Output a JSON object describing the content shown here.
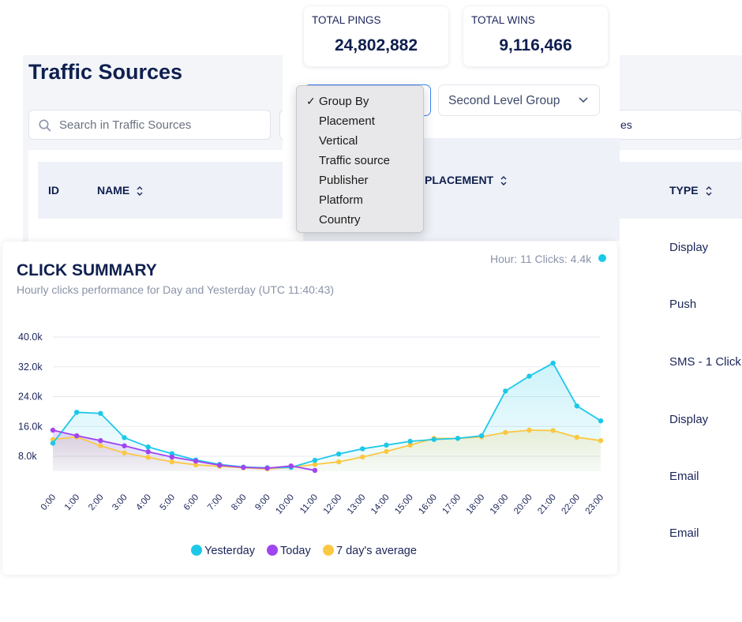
{
  "traffic_sources": {
    "title": "Traffic Sources",
    "search_placeholder": "Search in Traffic Sources",
    "filter_tail": "es",
    "columns": {
      "id": "ID",
      "name": "NAME",
      "placement": "PLACEMENT",
      "type": "TYPE"
    },
    "type_values": [
      "Display",
      "Push",
      "SMS - 1 Click",
      "Display",
      "Email",
      "Email"
    ]
  },
  "stats": {
    "total_pings_label": "TOTAL PINGS",
    "total_pings_value": "24,802,882",
    "total_wins_label": "TOTAL WINS",
    "total_wins_value": "9,116,466"
  },
  "group_by": {
    "second_level_label": "Second Level Group",
    "options": [
      "Group By",
      "Placement",
      "Vertical",
      "Traffic source",
      "Publisher",
      "Platform",
      "Country"
    ],
    "selected": "Group By"
  },
  "click_summary": {
    "title": "CLICK SUMMARY",
    "subtitle": "Hourly clicks performance for Day and Yesterday (UTC 11:40:43)",
    "tooltip": "Hour: 11 Clicks: 4.4k",
    "legend": [
      "Yesterday",
      "Today",
      "7 day's average"
    ]
  },
  "colors": {
    "yesterday": "#1cc8e8",
    "today": "#a145ef",
    "average": "#fbc843",
    "text": "#1b2559"
  },
  "chart_data": {
    "type": "area",
    "x": [
      "0:00",
      "1:00",
      "2:00",
      "3:00",
      "4:00",
      "5:00",
      "6:00",
      "7:00",
      "8:00",
      "9:00",
      "10:00",
      "11:00",
      "12:00",
      "13:00",
      "14:00",
      "15:00",
      "16:00",
      "17:00",
      "18:00",
      "19:00",
      "20:00",
      "21:00",
      "22:00",
      "23:00"
    ],
    "y_ticks": [
      "40.0k",
      "32.0k",
      "24.0k",
      "16.0k",
      "8.0k"
    ],
    "ylim": [
      0,
      40000
    ],
    "grid": true,
    "legend_position": "bottom",
    "series": [
      {
        "name": "Yesterday",
        "values": [
          11500,
          19800,
          19500,
          13000,
          10500,
          8700,
          7000,
          5800,
          5100,
          4900,
          5000,
          6900,
          8600,
          10000,
          11000,
          12000,
          12500,
          12800,
          13500,
          25500,
          29500,
          33000,
          21500,
          17500
        ]
      },
      {
        "name": "Today",
        "values": [
          15000,
          13500,
          12200,
          10800,
          9200,
          7800,
          6700,
          5600,
          5000,
          4800,
          5400,
          4200
        ]
      },
      {
        "name": "7 day's average",
        "values": [
          12500,
          13200,
          10800,
          8900,
          7700,
          6500,
          5700,
          5300,
          4900,
          4600,
          5000,
          5800,
          6500,
          7800,
          9300,
          11000,
          12800,
          12800,
          13200,
          14400,
          15000,
          14900,
          13100,
          12200
        ]
      }
    ]
  }
}
